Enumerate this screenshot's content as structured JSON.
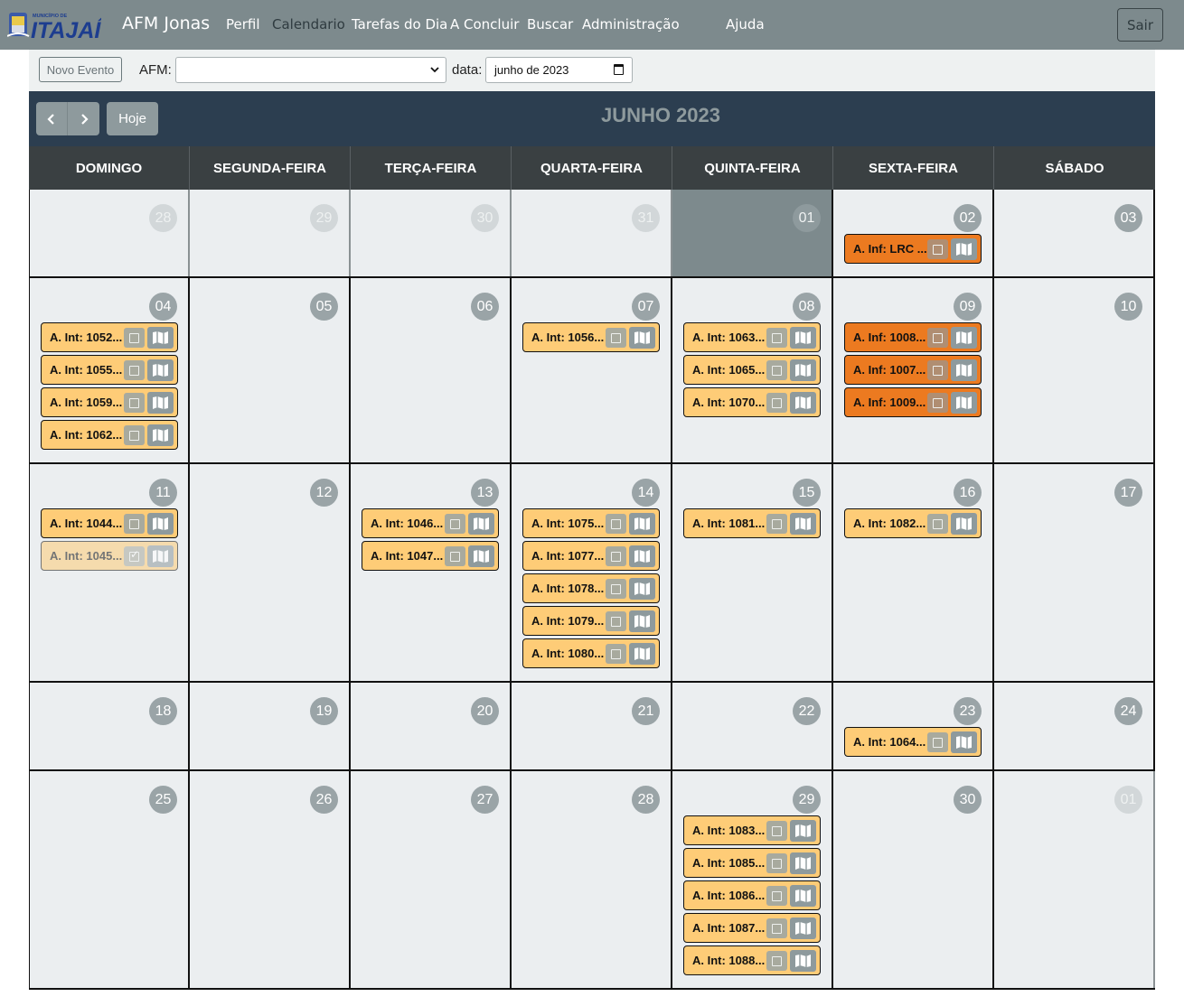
{
  "brand": {
    "municipio": "MUNICÍPIO DE",
    "city": "ITAJAÍ",
    "name": "AFM Jonas"
  },
  "nav": [
    {
      "label": "Perfil",
      "active": false
    },
    {
      "label": "Calendario",
      "active": true
    },
    {
      "label": "Tarefas do Dia",
      "active": false
    },
    {
      "label": "A Concluir",
      "active": false
    },
    {
      "label": "Buscar",
      "active": false
    },
    {
      "label": "Administração",
      "active": false
    },
    {
      "label": "Ajuda",
      "active": false
    }
  ],
  "logout_label": "Sair",
  "toolbar": {
    "novo_evento_label": "Novo Evento",
    "afm_label": "AFM:",
    "afm_value": "",
    "data_label": "data:",
    "data_value": "junho de 2023"
  },
  "calendar": {
    "title": "JUNHO 2023",
    "today_label": "Hoje",
    "weekdays": [
      "DOMINGO",
      "SEGUNDA-FEIRA",
      "TERÇA-FEIRA",
      "QUARTA-FEIRA",
      "QUINTA-FEIRA",
      "SEXTA-FEIRA",
      "SÁBADO"
    ],
    "weeks": [
      [
        {
          "num": "28",
          "other": true,
          "events": []
        },
        {
          "num": "29",
          "other": true,
          "events": []
        },
        {
          "num": "30",
          "other": true,
          "events": []
        },
        {
          "num": "31",
          "other": true,
          "events": []
        },
        {
          "num": "01",
          "today": true,
          "events": []
        },
        {
          "num": "02",
          "events": [
            {
              "label": "A. Inf: LRC ...",
              "type": "inf"
            }
          ]
        },
        {
          "num": "03",
          "events": []
        }
      ],
      [
        {
          "num": "04",
          "events": [
            {
              "label": "A. Int: 1052...",
              "type": "int"
            },
            {
              "label": "A. Int: 1055...",
              "type": "int"
            },
            {
              "label": "A. Int: 1059...",
              "type": "int"
            },
            {
              "label": "A. Int: 1062...",
              "type": "int"
            }
          ]
        },
        {
          "num": "05",
          "events": []
        },
        {
          "num": "06",
          "events": []
        },
        {
          "num": "07",
          "events": [
            {
              "label": "A. Int: 1056...",
              "type": "int"
            }
          ]
        },
        {
          "num": "08",
          "events": [
            {
              "label": "A. Int: 1063...",
              "type": "int"
            },
            {
              "label": "A. Int: 1065...",
              "type": "int"
            },
            {
              "label": "A. Int: 1070...",
              "type": "int"
            }
          ]
        },
        {
          "num": "09",
          "events": [
            {
              "label": "A. Inf: 1008...",
              "type": "inf"
            },
            {
              "label": "A. Inf: 1007...",
              "type": "inf"
            },
            {
              "label": "A. Inf: 1009...",
              "type": "inf"
            }
          ]
        },
        {
          "num": "10",
          "events": []
        }
      ],
      [
        {
          "num": "11",
          "events": [
            {
              "label": "A. Int: 1044...",
              "type": "int"
            },
            {
              "label": "A. Int: 1045...",
              "type": "int",
              "done": true
            }
          ]
        },
        {
          "num": "12",
          "events": []
        },
        {
          "num": "13",
          "events": [
            {
              "label": "A. Int: 1046...",
              "type": "int"
            },
            {
              "label": "A. Int: 1047...",
              "type": "int"
            }
          ]
        },
        {
          "num": "14",
          "events": [
            {
              "label": "A. Int: 1075...",
              "type": "int"
            },
            {
              "label": "A. Int: 1077...",
              "type": "int"
            },
            {
              "label": "A. Int: 1078...",
              "type": "int"
            },
            {
              "label": "A. Int: 1079...",
              "type": "int"
            },
            {
              "label": "A. Int: 1080...",
              "type": "int"
            }
          ]
        },
        {
          "num": "15",
          "events": [
            {
              "label": "A. Int: 1081...",
              "type": "int"
            }
          ]
        },
        {
          "num": "16",
          "events": [
            {
              "label": "A. Int: 1082...",
              "type": "int"
            }
          ]
        },
        {
          "num": "17",
          "events": []
        }
      ],
      [
        {
          "num": "18",
          "events": []
        },
        {
          "num": "19",
          "events": []
        },
        {
          "num": "20",
          "events": []
        },
        {
          "num": "21",
          "events": []
        },
        {
          "num": "22",
          "events": []
        },
        {
          "num": "23",
          "events": [
            {
              "label": "A. Int: 1064...",
              "type": "int"
            }
          ]
        },
        {
          "num": "24",
          "events": []
        }
      ],
      [
        {
          "num": "25",
          "events": []
        },
        {
          "num": "26",
          "events": []
        },
        {
          "num": "27",
          "events": []
        },
        {
          "num": "28",
          "events": []
        },
        {
          "num": "29",
          "events": [
            {
              "label": "A. Int: 1083...",
              "type": "int"
            },
            {
              "label": "A. Int: 1085...",
              "type": "int"
            },
            {
              "label": "A. Int: 1086...",
              "type": "int"
            },
            {
              "label": "A. Int: 1087...",
              "type": "int"
            },
            {
              "label": "A. Int: 1088...",
              "type": "int"
            }
          ]
        },
        {
          "num": "30",
          "events": []
        },
        {
          "num": "01",
          "other": true,
          "events": []
        }
      ]
    ]
  },
  "colors": {
    "navbar": "#7d8a8d",
    "calendar_header": "#2c3e50",
    "event_int": "#fecc77",
    "event_inf": "#ec7a20",
    "today_bg": "#7d8a8d"
  },
  "icons": {
    "prev": "chevron-left-icon",
    "next": "chevron-right-icon",
    "checkbox": "checkbox-icon",
    "map": "map-icon",
    "calendar": "calendar-icon",
    "select": "chevron-down-icon"
  }
}
